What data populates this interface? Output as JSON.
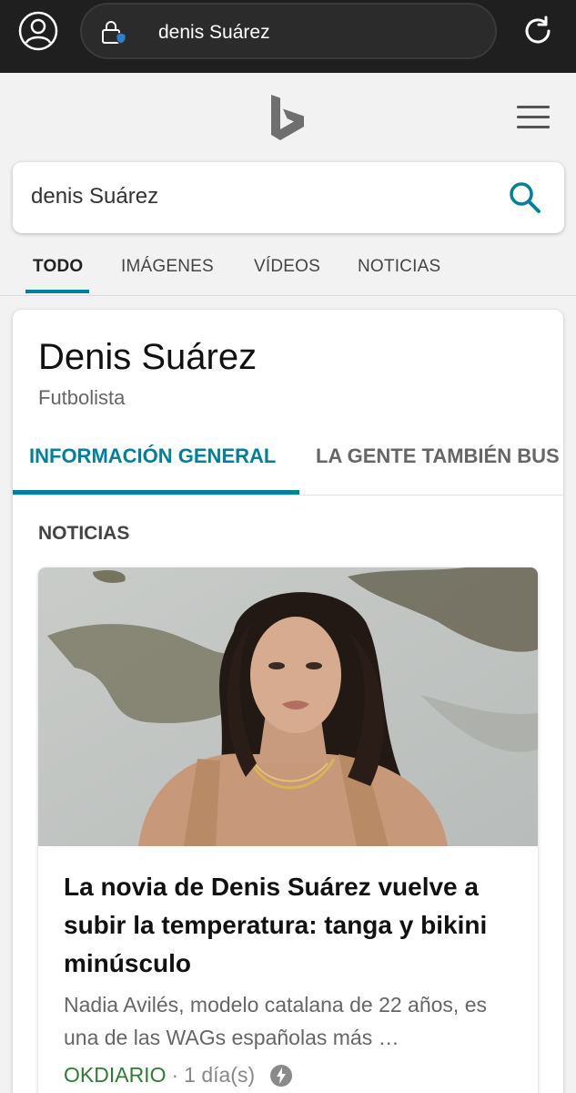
{
  "browser": {
    "url_text": "denis Suárez",
    "icons": [
      "profile-icon",
      "lock-shield-icon",
      "refresh-icon"
    ]
  },
  "header": {
    "logo": "bing-logo",
    "menu_icon": "hamburger-icon"
  },
  "search": {
    "value": "denis Suárez",
    "icon": "search-icon",
    "accent_color": "#00809d"
  },
  "scope_tabs": [
    {
      "label": "TODO",
      "active": true
    },
    {
      "label": "IMÁGENES",
      "active": false
    },
    {
      "label": "VÍDEOS",
      "active": false
    },
    {
      "label": "NOTICIAS",
      "active": false
    }
  ],
  "entity": {
    "title": "Denis Suárez",
    "subtitle": "Futbolista",
    "tabs": [
      {
        "label": "INFORMACIÓN GENERAL",
        "active": true
      },
      {
        "label": "LA GENTE TAMBIÉN BUS",
        "active": false
      }
    ],
    "section_heading": "NOTICIAS",
    "news": {
      "title": "La novia de Denis Suárez vuelve a subir la temperatura: tanga y bikini minúsculo",
      "snippet": "Nadia Avilés, modelo catalana de 22 años, es una de las WAGs españolas más …",
      "source": "OKDIARIO",
      "separator": "·",
      "time": "1 día(s)",
      "badge_icon": "lightning-icon"
    }
  }
}
